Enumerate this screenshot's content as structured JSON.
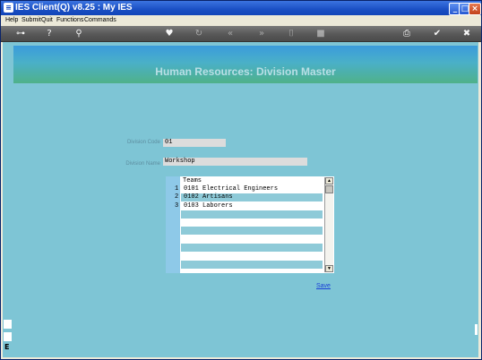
{
  "window": {
    "title": "IES Client(Q) v8.25 : My IES",
    "app_icon_glyph": "≡",
    "minimize_glyph": "_",
    "maximize_glyph": "□",
    "close_glyph": "×"
  },
  "menu": {
    "items": [
      "Help",
      "Submit",
      "Quit",
      "Functions",
      "Commands"
    ]
  },
  "toolbar": {
    "icons": [
      {
        "name": "key-icon",
        "glyph": "⊶"
      },
      {
        "name": "help-icon",
        "glyph": "?"
      },
      {
        "name": "search-icon",
        "glyph": "⚲"
      },
      {
        "name": "heart-icon",
        "glyph": "♥"
      },
      {
        "name": "refresh-icon",
        "glyph": "↻"
      },
      {
        "name": "rewind-icon",
        "glyph": "«"
      },
      {
        "name": "forward-icon",
        "glyph": "»"
      },
      {
        "name": "document-icon",
        "glyph": "⌷"
      },
      {
        "name": "stop-icon",
        "glyph": "■"
      },
      {
        "name": "print-icon",
        "glyph": "⎙"
      },
      {
        "name": "check-icon",
        "glyph": "✔"
      },
      {
        "name": "exit-icon",
        "glyph": "✖"
      }
    ]
  },
  "page": {
    "title": "Human Resources: Division Master"
  },
  "form": {
    "division_code_label": "Division Code",
    "division_code_value": "01",
    "division_name_label": "Division Name",
    "division_name_value": "Workshop"
  },
  "teams_grid": {
    "header": "Teams",
    "rows": [
      {
        "num": "1",
        "value": "0101 Electrical Engineers"
      },
      {
        "num": "2",
        "value": "0102 Artisans"
      },
      {
        "num": "3",
        "value": "0103 Laborers"
      },
      {
        "num": "",
        "value": ""
      },
      {
        "num": "",
        "value": ""
      },
      {
        "num": "",
        "value": ""
      },
      {
        "num": "",
        "value": ""
      },
      {
        "num": "",
        "value": ""
      },
      {
        "num": "",
        "value": ""
      },
      {
        "num": "",
        "value": ""
      }
    ],
    "scroll_up_glyph": "▲",
    "scroll_down_glyph": "▼"
  },
  "actions": {
    "save_label": "Save"
  },
  "left_edge": {
    "glyph": "E"
  },
  "colors": {
    "client_background": "#7ec5d5",
    "header_gradient_top": "#3a9bdc",
    "header_gradient_bottom": "#4fb189",
    "title_text": "#b9dfe6",
    "row_alt": "#8ecad8",
    "link": "#1a3fd6"
  }
}
